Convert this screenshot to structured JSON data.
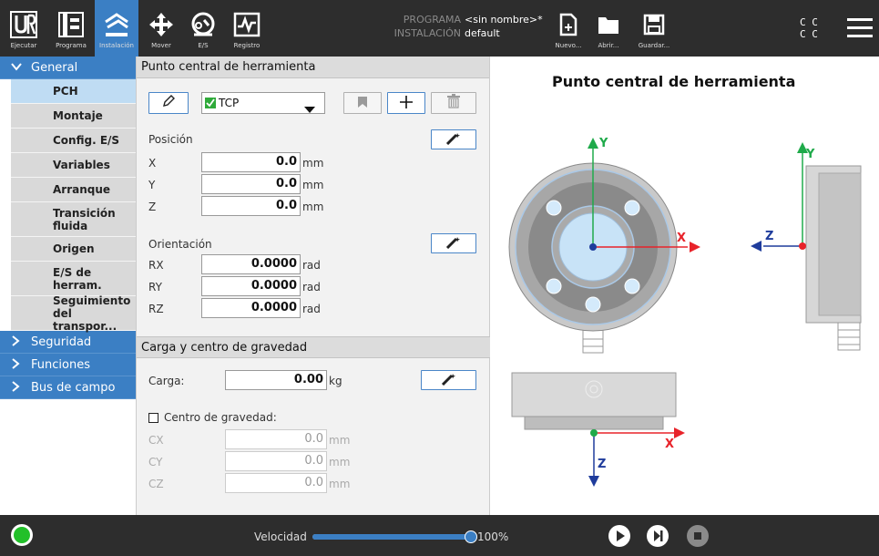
{
  "topbar": {
    "tabs": [
      {
        "label": "Ejecutar",
        "icon": "ur-logo-icon"
      },
      {
        "label": "Programa",
        "icon": "program-icon"
      },
      {
        "label": "Instalación",
        "icon": "installation-icon"
      }
    ],
    "actions": [
      {
        "label": "Mover",
        "icon": "move-icon"
      },
      {
        "label": "E/S",
        "icon": "io-icon"
      },
      {
        "label": "Registro",
        "icon": "log-icon"
      }
    ],
    "program_key": "PROGRAMA",
    "program_value": "<sin nombre>*",
    "installation_key": "INSTALACIÓN",
    "installation_value": "default",
    "file_buttons": [
      {
        "label": "Nuevo...",
        "icon": "new-file-icon"
      },
      {
        "label": "Abrir...",
        "icon": "folder-icon"
      },
      {
        "label": "Guardar...",
        "icon": "save-icon"
      }
    ],
    "cc_line1": "C C",
    "cc_line2": "C C",
    "accent": "#3b7fc4"
  },
  "sidebar": {
    "groups": [
      {
        "label": "General",
        "expanded": true
      },
      {
        "label": "Seguridad",
        "expanded": false
      },
      {
        "label": "Funciones",
        "expanded": false
      },
      {
        "label": "Bus de campo",
        "expanded": false
      }
    ],
    "items": [
      {
        "label": "PCH",
        "selected": true
      },
      {
        "label": "Montaje"
      },
      {
        "label": "Config. E/S"
      },
      {
        "label": "Variables"
      },
      {
        "label": "Arranque"
      },
      {
        "label": "Transición fluida"
      },
      {
        "label": "Origen"
      },
      {
        "label": "E/S de herram."
      },
      {
        "label": "Seguimiento del transpor..."
      }
    ]
  },
  "tcp": {
    "section_title": "Punto central de herramienta",
    "selected_tcp": "TCP",
    "position_label": "Posición",
    "position": [
      {
        "axis": "X",
        "value": "0.0",
        "unit": "mm"
      },
      {
        "axis": "Y",
        "value": "0.0",
        "unit": "mm"
      },
      {
        "axis": "Z",
        "value": "0.0",
        "unit": "mm"
      }
    ],
    "orientation_label": "Orientación",
    "orientation": [
      {
        "axis": "RX",
        "value": "0.0000",
        "unit": "rad"
      },
      {
        "axis": "RY",
        "value": "0.0000",
        "unit": "rad"
      },
      {
        "axis": "RZ",
        "value": "0.0000",
        "unit": "rad"
      }
    ]
  },
  "payload": {
    "section_title": "Carga y centro de gravedad",
    "load_label": "Carga:",
    "load_value": "0.00",
    "load_unit": "kg",
    "cog_label": "Centro de gravedad:",
    "cog": [
      {
        "axis": "CX",
        "value": "0.0",
        "unit": "mm"
      },
      {
        "axis": "CY",
        "value": "0.0",
        "unit": "mm"
      },
      {
        "axis": "CZ",
        "value": "0.0",
        "unit": "mm"
      }
    ]
  },
  "preview": {
    "title": "Punto central de herramienta",
    "axis_x": "X",
    "axis_y": "Y",
    "axis_z": "Z",
    "colors": {
      "x": "#e8232a",
      "y": "#1faa4a",
      "z": "#1f3c9c"
    }
  },
  "footer": {
    "speed_label": "Velocidad",
    "speed_percent": "100%",
    "speed_fraction": 1.0,
    "status_color": "#22c02a"
  }
}
